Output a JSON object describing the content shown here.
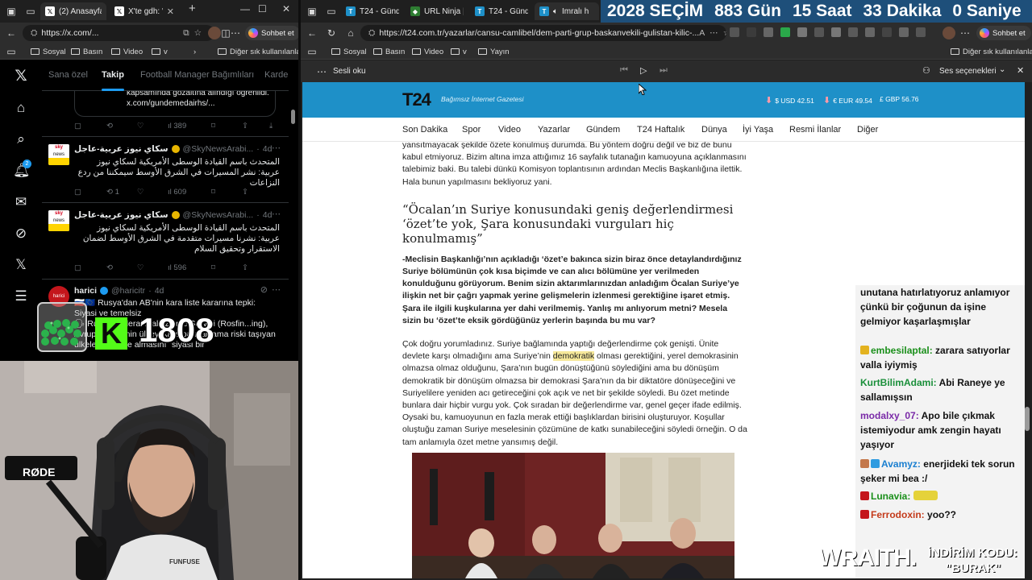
{
  "left_browser": {
    "tabs": [
      {
        "label": "(2) Anasayfa / X",
        "icon": "x-icon"
      },
      {
        "label": "X'te gdh: \"Gö",
        "icon": "x-icon"
      }
    ],
    "url": "https://x.com/...",
    "copilot_label": "Sohbet et",
    "favorites": [
      "Sosyal",
      "Basın",
      "Video",
      "v"
    ],
    "favorites_more": "Diğer sık kullanılanlar"
  },
  "x_app": {
    "rail_icons": [
      "x-logo-icon",
      "home-icon",
      "search-icon",
      "notifications-icon",
      "messages-icon",
      "grok-icon",
      "x-premium-icon",
      "lists-icon"
    ],
    "notification_badge": "2",
    "tabs": [
      "Sana özel",
      "Takip",
      "Football Manager Bağımlıları",
      "Karde"
    ],
    "active_tab_index": 1,
    "tweets": [
      {
        "body": "kapsamında gözaltına alındığı öğrenildi.\nx.com/gundemedairhs/...",
        "stats": {
          "views": "389"
        }
      },
      {
        "name": "سكاي نيوز عربية-عاجل",
        "handle": "@SkyNewsArabi...",
        "time": "4d",
        "body": "المتحدث باسم القيادة الوسطى الأمريكية لسكاي نيوز عربية: نشر المسيرات في الشرق الأوسط سيمكننا من ردع النزاعات",
        "stats": {
          "retweets": "1",
          "views": "609"
        }
      },
      {
        "name": "سكاي نيوز عربية-عاجل",
        "handle": "@SkyNewsArabi...",
        "time": "4d",
        "body": "المتحدث باسم القيادة الوسطى الأمريكية لسكاي نيوز عربية: نشرنا مسيرات متقدمة في الشرق الأوسط لضمان الاستقرار وتحقيق السلام",
        "stats": {
          "views": "596"
        }
      },
      {
        "name": "harici",
        "handle": "@haricitr",
        "time": "4d",
        "body": "🇷🇺🇪🇺 Rusya'dan AB'nin kara liste kararına tepki: Siyasi ve temelsiz\n🗣 Rusya Federal Mali İzleme Servisi (Rosfin...ing), Avrupa Birliği'nin ülkeyi kara para aklama riski taşıyan ülkeler listesine almasını \"siyasi bir"
      }
    ]
  },
  "stream_overlay": {
    "viewer_count": "1808",
    "kick_logo_letter": "K",
    "mic_brand": "RØDE",
    "shirt_brand": "FUNFUSE",
    "sponsor_brand": "WRAITH.",
    "sponsor_promo_label": "İNDİRİM KODU:",
    "sponsor_promo_code": "\"BURAK\""
  },
  "right_browser": {
    "tabs": [
      {
        "label": "T24 - Günd",
        "icon": "t24-icon"
      },
      {
        "label": "URL Ninja |",
        "icon": "shield-icon"
      },
      {
        "label": "T24 - Günd",
        "icon": "t24-icon"
      },
      {
        "label": "İmralı h",
        "icon": "speaker-icon"
      }
    ],
    "url": "https://t24.com.tr/yazarlar/cansu-camlibel/dem-parti-grup-baskanvekili-gulistan-kilic-...",
    "copilot_label": "Sohbet et",
    "favorites": [
      "Sosyal",
      "Basın",
      "Video",
      "v",
      "Yayın"
    ],
    "favorites_more": "Diğer sık kullanılanlar",
    "countdown": [
      "2028 SEÇİM",
      "883 Gün",
      "15 Saat",
      "33 Dakika",
      "0 Saniye"
    ],
    "read_aloud": {
      "label": "Sesli oku",
      "voice_options": "Ses seçenekleri"
    }
  },
  "t24": {
    "logo": "T24",
    "slogan": "Bağımsız İnternet Gazetesi",
    "rates": [
      {
        "label": "$ USD 42.51",
        "trend": "down"
      },
      {
        "label": "€ EUR 49.54",
        "trend": "down"
      },
      {
        "label": "£ GBP 56.76",
        "trend": "none"
      }
    ],
    "nav": [
      "Son Dakika",
      "Spor",
      "Video",
      "Yazarlar",
      "Gündem",
      "T24 Haftalık",
      "Dünya",
      "İyi Yaşa",
      "Resmi İlanlar",
      "Diğer"
    ],
    "article": {
      "p_intro": "yansıtmayacak şekilde özete konulmuş durumda. Bu yöntem doğru değil ve biz de bunu kabul etmiyoruz. Bizim altına imza attığımız 16 sayfalık tutanağın kamuoyuna açıklanmasını talebimiz baki. Bu talebi dünkü Komisyon toplantısının ardından Meclis Başkanlığına ilettik. Hala bunun yapılmasını bekliyoruz yani.",
      "heading": "“Öcalan’ın Suriye konusundaki geniş değerlendirmesi ‘özet’te yok, Şara konusundaki vurguları hiç konulmamış”",
      "question": "-Meclisin Başkanlığı’nın açıkladığı ‘özet’e bakınca sizin biraz önce detaylandırdığınız Suriye bölümünün çok kısa biçimde ve can alıcı bölümüne yer verilmeden konulduğunu görüyorum. Benim sizin aktarımlarınızdan anladığım Öcalan Suriye’ye ilişkin net bir çağrı yapmak yerine gelişmelerin izlenmesi gerektiğine işaret etmiş. Şara ile ilgili kuşkularına yer dahi verilmemiş. Yanlış mı anlıyorum metni? Mesela sizin bu ‘özet’te eksik gördüğünüz yerlerin başında bu mu var?",
      "answer_1": "Çok doğru yorumladınız. Suriye bağlamında yaptığı değerlendirme çok genişti. Ünite devlete karşı olmadığını ama Suriye’nin ",
      "answer_highlight": "demokratik",
      "answer_2": " olması gerektiğini, yerel demokrasinin olmazsa olmaz olduğunu, Şara’nın bugün dönüştüğünü söylediğini ama bu dönüşüm demokratik bir dönüşüm olmazsa bir demokrasi Şara’nın da bir diktatöre dönüşeceğini ve Suriyelilere yeniden acı getireceğini çok açık ve net bir şekilde söyledi. Bu özet metinde bunlara dair hiçbir vurgu yok. Çok sıradan bir değerlendirme var, genel geçer ifade edilmiş. Oysaki bu, kamuoyunun en fazla merak ettiği başlıklardan birisini oluşturuyor. Koşullar oluştuğu zaman Suriye meselesinin çözümüne de katkı sunabileceğini söyledi örneğin. O da tam anlamıyla özet metne yansımış değil."
    }
  },
  "chat": {
    "messages": [
      {
        "user": "",
        "text": "unutana hatırlatıyoruz anlamıyor çünkü bir çoğunun da işine gelmiyor kaşarlaşmışlar",
        "color": "#111111"
      },
      {
        "user": "embesilaptal:",
        "text": "zarara satıyorlar valla iyiymiş",
        "color": "#1a8f1a"
      },
      {
        "user": "KurtBilimAdami:",
        "text": "Abi Raneye ye sallamışsın",
        "color": "#1a8f3a"
      },
      {
        "user": "modalxy_07:",
        "text": "Apo bile çıkmak istemiyodur amk zengin hayatı yaşıyor",
        "color": "#7a2aa8"
      },
      {
        "user": "Avamyz:",
        "text": "enerjideki tek sorun şeker mi bea :/",
        "color": "#1a7fd0"
      },
      {
        "user": "Lunavia:",
        "text": "",
        "color": "#1a8f1a"
      },
      {
        "user": "Ferrodoxin:",
        "text": "yoo??",
        "color": "#c43a1a"
      }
    ]
  }
}
